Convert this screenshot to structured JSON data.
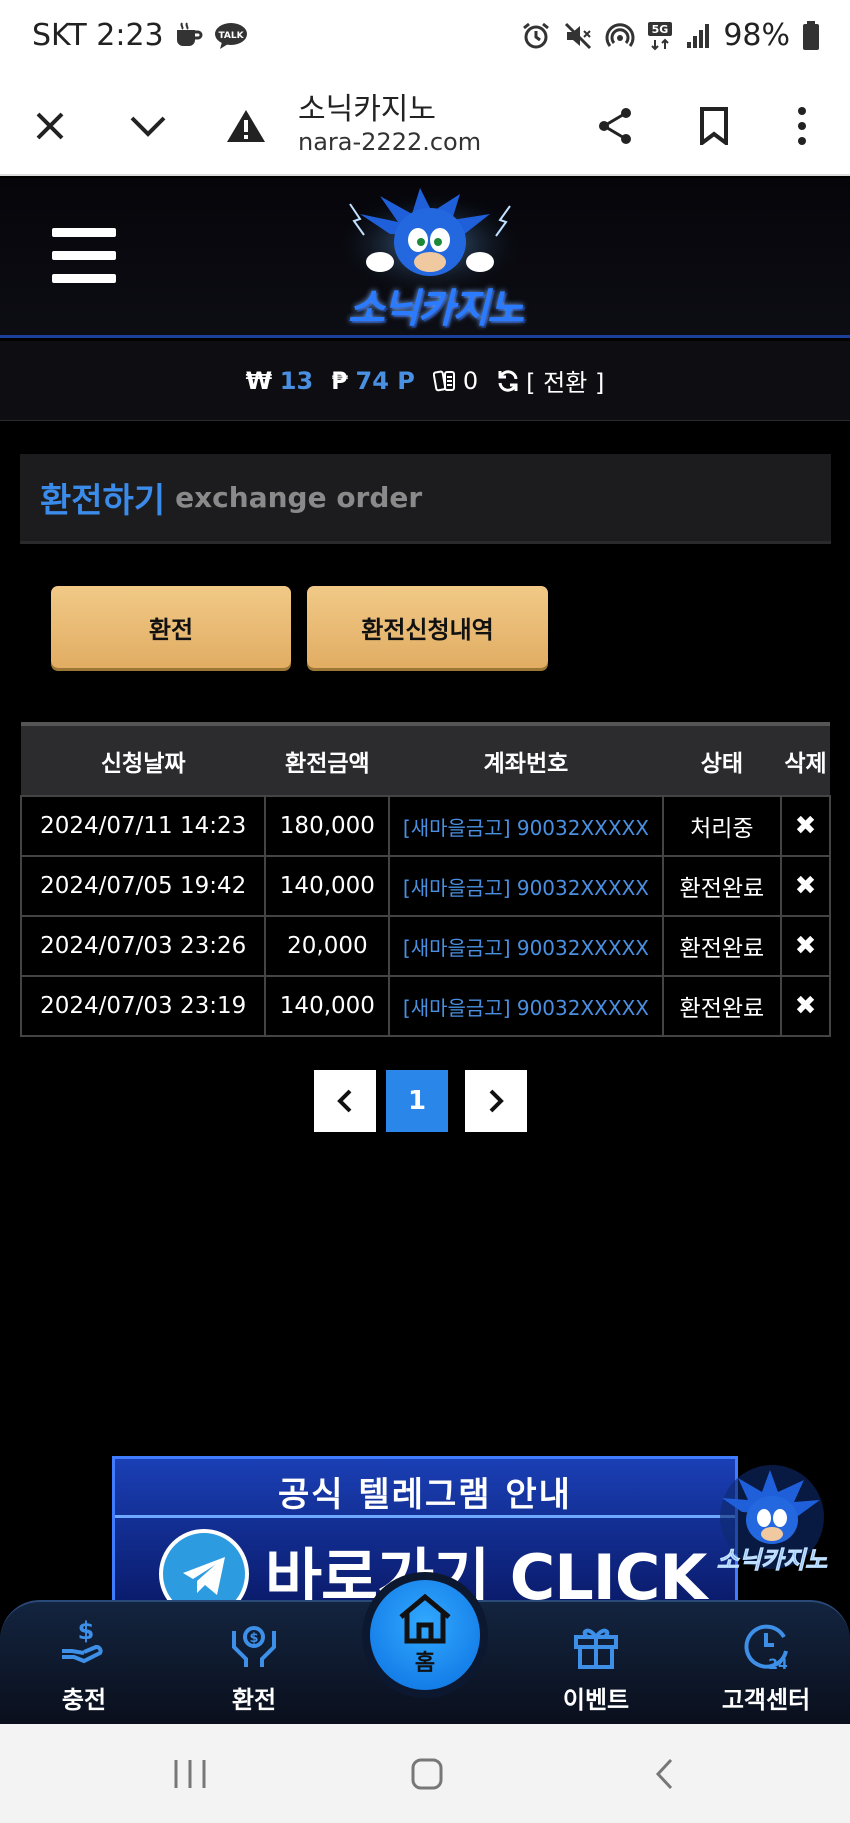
{
  "status_bar": {
    "carrier_time": "SKT 2:23",
    "talk_badge": "TALK",
    "network": "5G",
    "battery": "98%"
  },
  "browser": {
    "page_title": "소닉카지노",
    "url": "nara-2222.com"
  },
  "header": {
    "logo_text": "소닉카지노"
  },
  "balance": {
    "won_symbol": "₩",
    "won_value": "13",
    "point_symbol": "₱",
    "point_value": "74 P",
    "chip_value": "0",
    "convert_label": "[ 전환 ]"
  },
  "section": {
    "title_ko": "환전하기",
    "title_en": "exchange order"
  },
  "buttons": {
    "exchange": "환전",
    "exchange_history": "환전신청내역"
  },
  "table": {
    "headers": [
      "신청날짜",
      "환전금액",
      "계좌번호",
      "상태",
      "삭제"
    ],
    "rows": [
      {
        "date": "2024/07/11 14:23",
        "amount": "180,000",
        "account": "[새마을금고] 90032XXXXX",
        "status": "처리중",
        "delete": "✖"
      },
      {
        "date": "2024/07/05 19:42",
        "amount": "140,000",
        "account": "[새마을금고] 90032XXXXX",
        "status": "환전완료",
        "delete": "✖"
      },
      {
        "date": "2024/07/03 23:26",
        "amount": "20,000",
        "account": "[새마을금고] 90032XXXXX",
        "status": "환전완료",
        "delete": "✖"
      },
      {
        "date": "2024/07/03 23:19",
        "amount": "140,000",
        "account": "[새마을금고] 90032XXXXX",
        "status": "환전완료",
        "delete": "✖"
      }
    ]
  },
  "pagination": {
    "current": "1"
  },
  "banner": {
    "top_text": "공식 텔레그램 안내",
    "bottom_text": "바로가기 CLICK",
    "badge_text": "소닉카지노"
  },
  "bottom_nav": {
    "deposit": "충전",
    "exchange": "환전",
    "home": "홈",
    "event": "이벤트",
    "support": "고객센터"
  }
}
